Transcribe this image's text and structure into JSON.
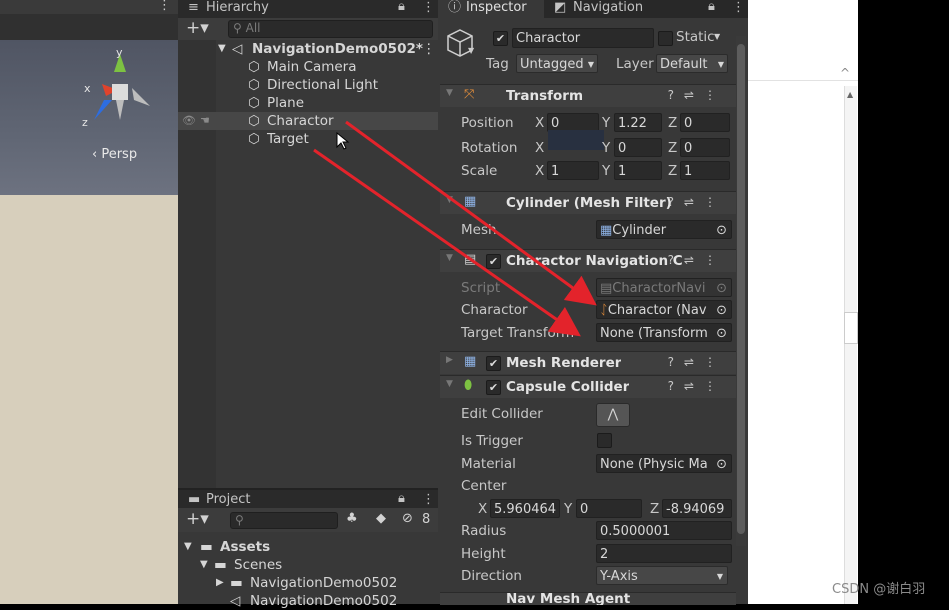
{
  "scene": {
    "persp_label": "‹ Persp",
    "axis_x": "x",
    "axis_y": "y",
    "axis_z": "z"
  },
  "hierarchy": {
    "tab": "Hierarchy",
    "search_placeholder": "All",
    "scene_name": "NavigationDemo0502*",
    "items": [
      "Main Camera",
      "Directional Light",
      "Plane",
      "Charactor",
      "Target"
    ]
  },
  "project": {
    "tab": "Project",
    "badge": "8",
    "tree": [
      "Assets",
      "Scenes",
      "NavigationDemo0502",
      "NavigationDemo0502"
    ]
  },
  "inspector": {
    "tab": "Inspector",
    "tab2": "Navigation",
    "object_name": "Charactor",
    "static_label": "Static",
    "tag_label": "Tag",
    "tag_value": "Untagged",
    "layer_label": "Layer",
    "layer_value": "Default",
    "transform": {
      "title": "Transform",
      "position_label": "Position",
      "pos_x": "0",
      "pos_y": "1.22",
      "pos_z": "0",
      "rotation_label": "Rotation",
      "rot_y": "0",
      "rot_z": "0",
      "scale_label": "Scale",
      "sc_x": "1",
      "sc_y": "1",
      "sc_z": "1"
    },
    "mesh_filter": {
      "title": "Cylinder (Mesh Filter)",
      "mesh_label": "Mesh",
      "mesh_value": "Cylinder"
    },
    "nav_script": {
      "title": "Charactor Navigation C",
      "script_label": "Script",
      "script_value": "CharactorNavi",
      "charactor_label": "Charactor",
      "charactor_value": "Charactor (Nav",
      "target_label": "Target Transform",
      "target_value": "None (Transform"
    },
    "mesh_renderer": {
      "title": "Mesh Renderer"
    },
    "capsule": {
      "title": "Capsule Collider",
      "edit_label": "Edit Collider",
      "trigger_label": "Is Trigger",
      "material_label": "Material",
      "material_value": "None (Physic Ma",
      "center_label": "Center",
      "c_x": "5.960464",
      "c_y": "0",
      "c_z": "-8.94069",
      "radius_label": "Radius",
      "radius_value": "0.5000001",
      "height_label": "Height",
      "height_value": "2",
      "direction_label": "Direction",
      "direction_value": "Y-Axis"
    },
    "next_title": "Nav Mesh Agent"
  },
  "watermark": "CSDN @谢白羽",
  "colors": {
    "arrow": "#e3232b",
    "panel": "#383838",
    "selection": "#474747"
  }
}
